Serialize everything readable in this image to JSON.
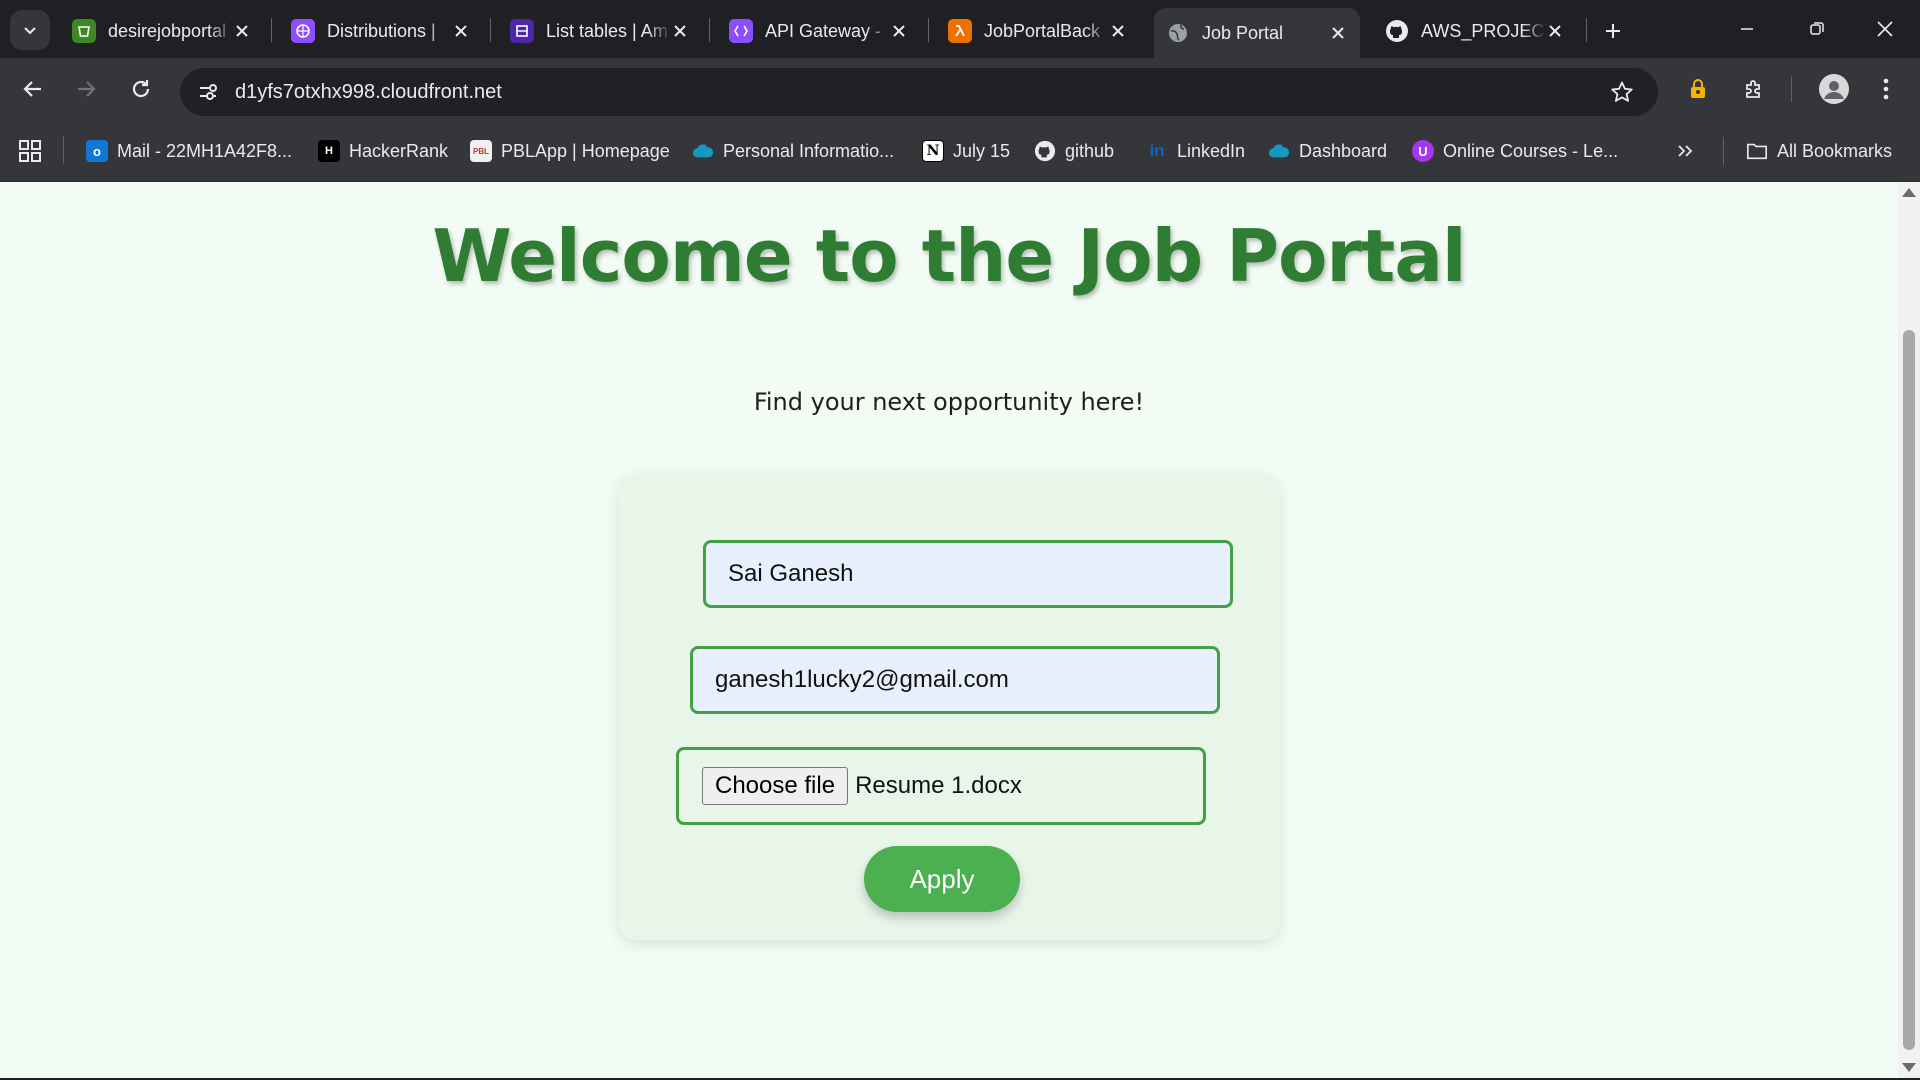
{
  "browser": {
    "tabs": [
      {
        "title": "desirejobportal",
        "icon": "s3-bucket-icon",
        "color": "#3f8624"
      },
      {
        "title": "Distributions | ",
        "icon": "cloudfront-icon",
        "color": "#8c4fff"
      },
      {
        "title": "List tables | Am",
        "icon": "dynamodb-icon",
        "color": "#4d27aa"
      },
      {
        "title": "API Gateway - ",
        "icon": "api-gateway-icon",
        "color": "#8c4fff"
      },
      {
        "title": "JobPortalBack",
        "icon": "lambda-icon",
        "color": "#ed7100"
      },
      {
        "title": "Job Portal",
        "icon": "globe-icon",
        "active": true
      },
      {
        "title": "AWS_PROJECT",
        "icon": "github-icon"
      }
    ],
    "url": "d1yfs7otxhx998.cloudfront.net",
    "bookmarks": [
      {
        "label": "Mail - 22MH1A42F8...",
        "icon": "outlook-icon",
        "color": "#0f78d4"
      },
      {
        "label": "HackerRank",
        "icon": "hackerrank-icon",
        "color": "#000000"
      },
      {
        "label": "PBLApp | Homepage",
        "icon": "pblapp-icon"
      },
      {
        "label": "Personal Informatio...",
        "icon": "salesforce-cloud-icon",
        "color": "#1798c1"
      },
      {
        "label": "July 15",
        "icon": "notion-icon"
      },
      {
        "label": "github",
        "icon": "github-icon"
      },
      {
        "label": "LinkedIn",
        "icon": "linkedin-icon",
        "color": "#0a66c2"
      },
      {
        "label": "Dashboard",
        "icon": "salesforce-cloud-icon",
        "color": "#1798c1"
      },
      {
        "label": "Online Courses - Le...",
        "icon": "udemy-icon",
        "color": "#a435f0"
      }
    ],
    "all_bookmarks_label": "All Bookmarks"
  },
  "page": {
    "title": "Welcome to the Job Portal",
    "subtitle": "Find your next opportunity here!",
    "form": {
      "name_value": "Sai Ganesh",
      "email_value": "ganesh1lucky2@gmail.com",
      "choose_file_label": "Choose file",
      "file_name": "Resume 1.docx",
      "apply_label": "Apply"
    }
  },
  "colors": {
    "accent_green": "#2e7d32",
    "button_green": "#4caf50",
    "field_border": "#43a047",
    "page_bg": "#f2fbf4",
    "card_bg": "#e8f5e9"
  }
}
